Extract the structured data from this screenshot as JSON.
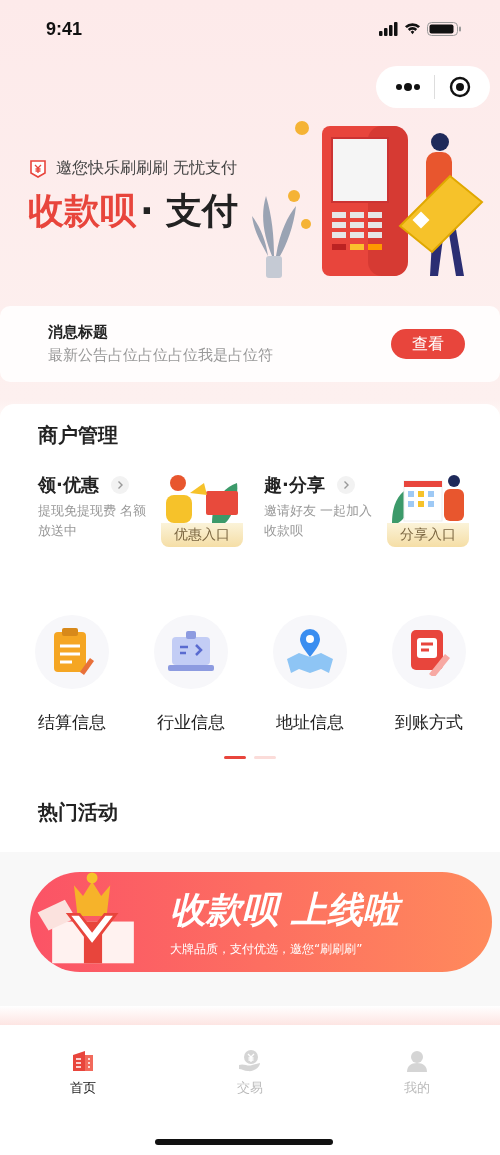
{
  "status_bar": {
    "time": "9:41"
  },
  "hero": {
    "tagline": "邀您快乐刷刷刷 无忧支付",
    "title_accent": "收款呗",
    "title_rest": "· 支付"
  },
  "notice": {
    "title": "消息标题",
    "text": "最新公告占位占位占位我是占位符",
    "button": "查看"
  },
  "merchant": {
    "title": "商户管理",
    "promos": [
      {
        "title": "领·优惠",
        "desc": "提现免提现费 名额放送中",
        "entry": "优惠入口",
        "kind": "coupon"
      },
      {
        "title": "趣·分享",
        "desc": "邀请好友 一起加入收款呗",
        "entry": "分享入口",
        "kind": "share"
      }
    ],
    "services": [
      {
        "label": "结算信息",
        "kind": "clipboard"
      },
      {
        "label": "行业信息",
        "kind": "terminal"
      },
      {
        "label": "地址信息",
        "kind": "map"
      },
      {
        "label": "到账方式",
        "kind": "document"
      }
    ],
    "pager": [
      {
        "selected": true
      },
      {
        "selected": false
      }
    ]
  },
  "activities": {
    "title": "热门活动",
    "banner": {
      "headline": "收款呗 上线啦",
      "subtitle": "大牌品质，支付优选，邀您“刷刷刷”"
    }
  },
  "tab_bar": [
    {
      "label": "首页",
      "selected": true,
      "kind": "home"
    },
    {
      "label": "交易",
      "selected": false,
      "kind": "trade"
    },
    {
      "label": "我的",
      "selected": false,
      "kind": "me"
    }
  ]
}
